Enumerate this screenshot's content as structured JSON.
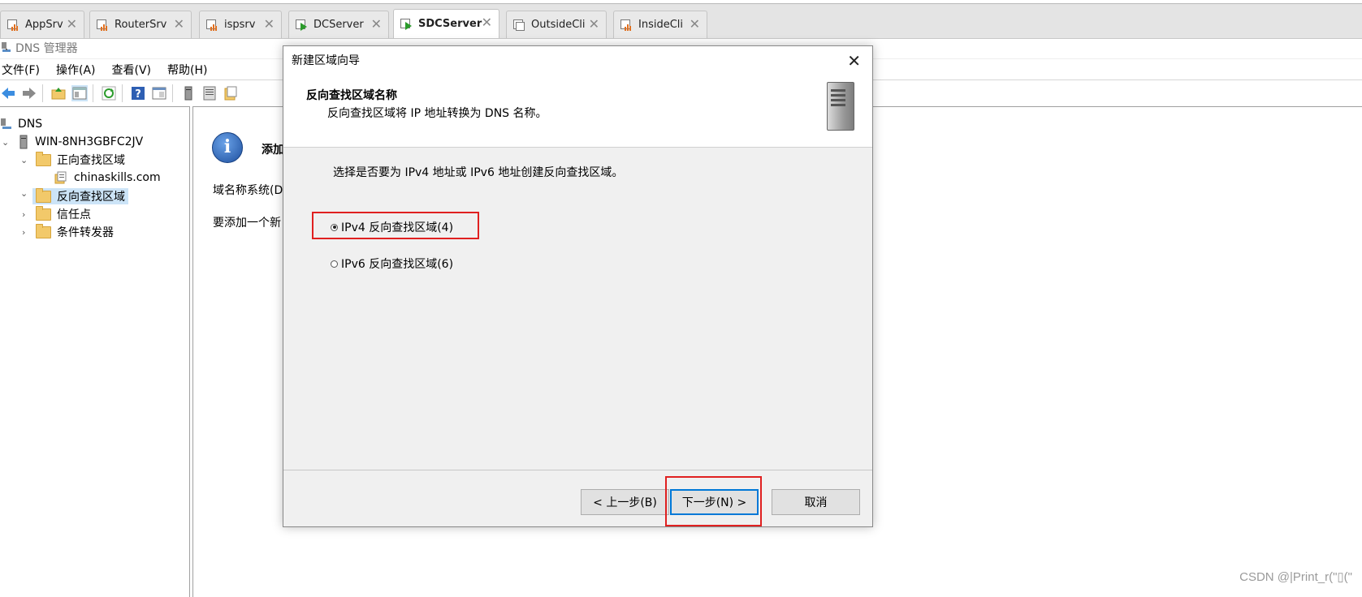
{
  "vm_tabs": [
    {
      "label": "AppSrv",
      "state": "running",
      "active": false
    },
    {
      "label": "RouterSrv",
      "state": "running",
      "active": false
    },
    {
      "label": "ispsrv",
      "state": "running",
      "active": false
    },
    {
      "label": "DCServer",
      "state": "playing",
      "active": false
    },
    {
      "label": "SDCServer",
      "state": "playing",
      "active": true
    },
    {
      "label": "OutsideCli",
      "state": "stopped",
      "active": false
    },
    {
      "label": "InsideCli",
      "state": "running",
      "active": false
    }
  ],
  "tab_close_glyph": "✕",
  "mmc": {
    "title": "DNS 管理器",
    "menu": [
      "文件(F)",
      "操作(A)",
      "查看(V)",
      "帮助(H)"
    ],
    "toolbar_icons": [
      "back-arrow-icon",
      "forward-arrow-icon",
      "up-folder-icon",
      "show-tree-icon",
      "refresh-icon",
      "help-icon",
      "properties-icon",
      "server-icon",
      "list-icon",
      "export-icon"
    ]
  },
  "tree": {
    "root": "DNS",
    "server": "WIN-8NH3GBFC2JV",
    "forward_zones": "正向查找区域",
    "forward_child": "chinaskills.com",
    "reverse_zones": "反向查找区域",
    "trust_points": "信任点",
    "conditional_forwarders": "条件转发器"
  },
  "result_pane": {
    "heading": "添加",
    "line1": "域名称系统(D",
    "line2": "要添加一个新"
  },
  "wizard": {
    "title": "新建区域向导",
    "close_glyph": "✕",
    "header_title": "反向查找区域名称",
    "header_subtitle": "反向查找区域将 IP 地址转换为 DNS 名称。",
    "prompt": "选择是否要为 IPv4 地址或 IPv6 地址创建反向查找区域。",
    "options": [
      {
        "label": "IPv4 反向查找区域(4)",
        "selected": true
      },
      {
        "label": "IPv6 反向查找区域(6)",
        "selected": false
      }
    ],
    "buttons": {
      "back": "< 上一步(B)",
      "next": "下一步(N) >",
      "cancel": "取消"
    }
  },
  "watermark": "CSDN @|Print_r(\"▯(\"",
  "colors": {
    "selection": "#cce4f7",
    "highlight_box": "#e02020",
    "default_button_border": "#0078d7"
  }
}
